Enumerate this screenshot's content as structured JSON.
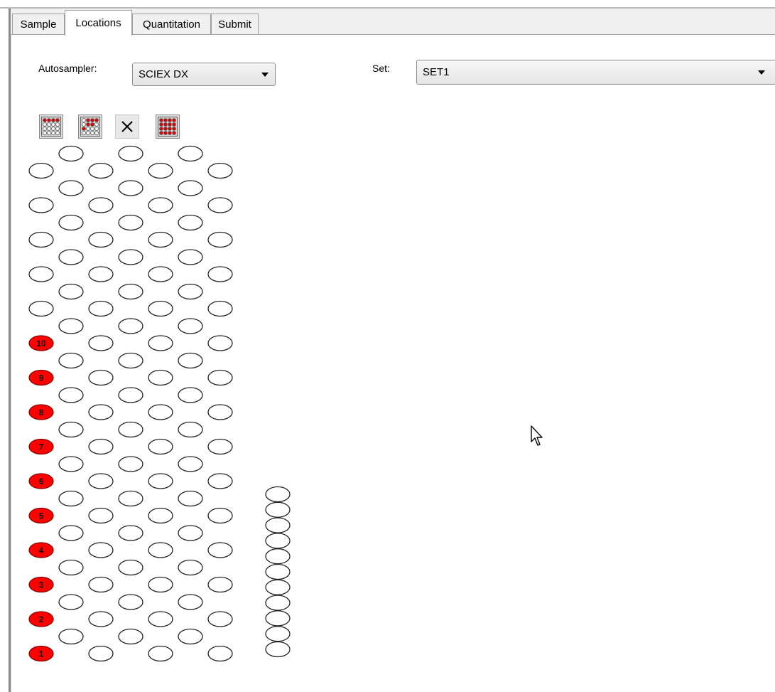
{
  "tabs": [
    {
      "label": "Sample",
      "active": false
    },
    {
      "label": "Locations",
      "active": true
    },
    {
      "label": "Quantitation",
      "active": false
    },
    {
      "label": "Submit",
      "active": false
    }
  ],
  "autosampler": {
    "label": "Autosampler:",
    "value": "SCIEX DX"
  },
  "set": {
    "label": "Set:",
    "value": "SET1"
  },
  "toolbar": {
    "buttons": [
      {
        "name": "select-row-icon"
      },
      {
        "name": "select-diagonal-icon"
      },
      {
        "name": "clear-selection-icon"
      },
      {
        "name": "select-all-icon"
      }
    ]
  },
  "rack": {
    "selected_color": "#ff0000",
    "selected_vials": [
      "1",
      "2",
      "3",
      "4",
      "5",
      "6",
      "7",
      "8",
      "9",
      "10"
    ],
    "extra_column_vial_count": 11
  }
}
